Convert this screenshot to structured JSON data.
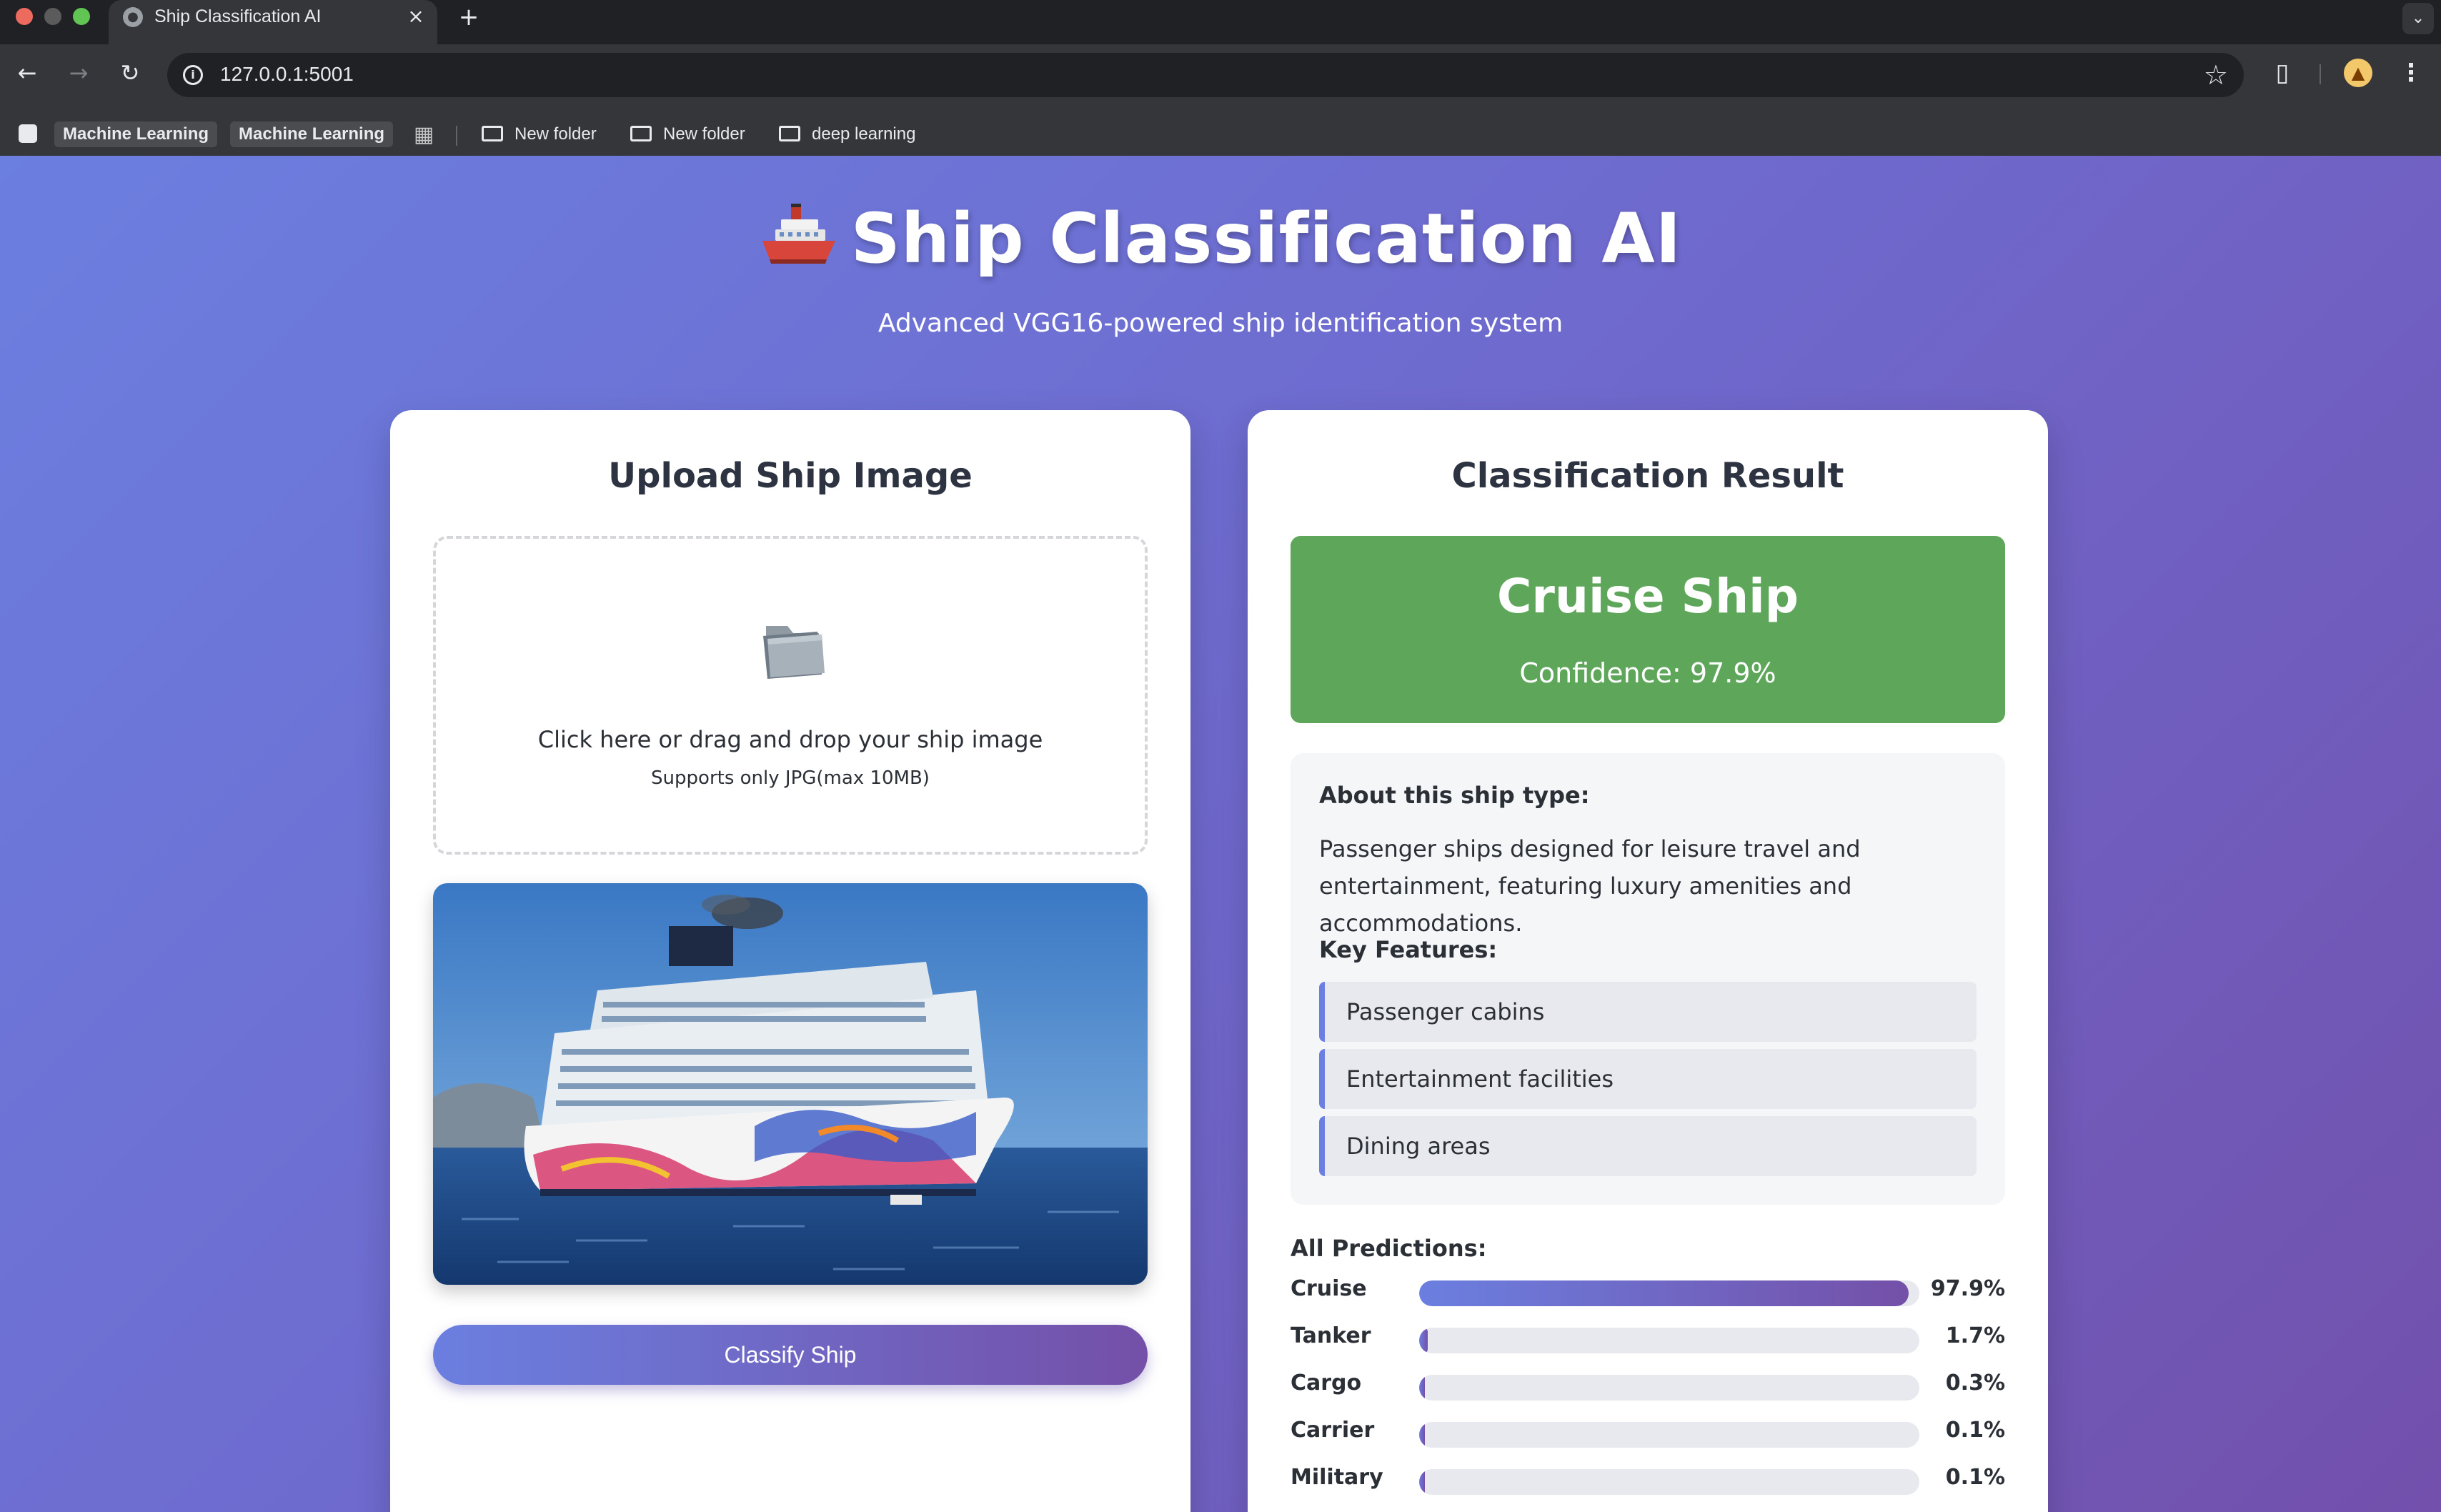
{
  "browser": {
    "tab_title": "Ship Classification AI",
    "url": "127.0.0.1:5001",
    "bookmarks": {
      "chip_1": "Machine Learning",
      "chip_2": "Machine Learning",
      "folder_1": "New folder",
      "folder_2": "New folder",
      "folder_3": "deep learning"
    }
  },
  "header": {
    "title": "Ship Classification AI",
    "subtitle": "Advanced VGG16-powered ship identification system"
  },
  "upload": {
    "title": "Upload Ship Image",
    "drop_text": "Click here or drag and drop your ship image",
    "drop_hint": "Supports only JPG(max 10MB)",
    "classify_label": "Classify Ship"
  },
  "result": {
    "title": "Classification Result",
    "predicted_class": "Cruise Ship",
    "confidence_text": "Confidence: 97.9%",
    "about_heading": "About this ship type:",
    "about_text": "Passenger ships designed for leisure travel and entertainment, featuring luxury amenities and accommodations.",
    "features_heading": "Key Features:",
    "features": [
      "Passenger cabins",
      "Entertainment facilities",
      "Dining areas"
    ],
    "predictions_heading": "All Predictions:",
    "predictions": [
      {
        "label": "Cruise",
        "value": "97.9%",
        "fraction": 0.979
      },
      {
        "label": "Tanker",
        "value": "1.7%",
        "fraction": 0.017
      },
      {
        "label": "Cargo",
        "value": "0.3%",
        "fraction": 0.003
      },
      {
        "label": "Carrier",
        "value": "0.1%",
        "fraction": 0.001
      },
      {
        "label": "Military",
        "value": "0.1%",
        "fraction": 0.001
      }
    ]
  },
  "colors": {
    "accent_start": "#6b7fe0",
    "accent_end": "#7450a8",
    "result_green": "#5ea65a"
  }
}
